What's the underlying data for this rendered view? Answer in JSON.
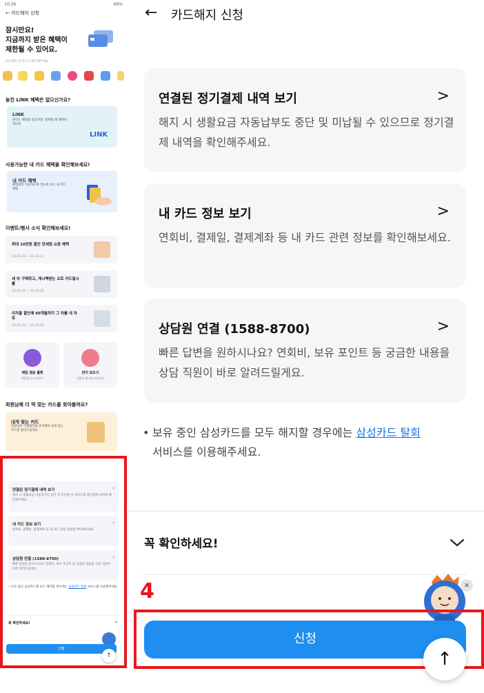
{
  "left_thumb": {
    "status_time": "10:26",
    "status_right": "66%",
    "title": "카드해지 신청",
    "hero_line1": "잠시만요!",
    "hero_line2": "지금까지 받은 혜택이",
    "hero_line3": "제한될 수 있어요.",
    "hero_sub": "카드해지 전 반드시 확인해주세요.",
    "sec_link": "놓친 LINK 혜택은 없으신가요?",
    "link_title": "LINK",
    "link_desc": "원하는 혜택을 링크하면, 결제할 때 혜택이 알아서",
    "link_brand": "LINK",
    "sec_benefit": "사용가능한 내 카드 혜택을 확인해보세요!",
    "benefit_title": "내 카드 혜택",
    "benefit_desc": "빠짐없이 이용하도록 한눈에 보는 내 카드 혜택",
    "sec_event": "이벤트/행사 소식 확인해보세요!",
    "events": [
      {
        "title": "최대 10만원 할인 연세컴 쇼핑 혜택",
        "date": "23.10.23 ~ 23.10.31"
      },
      {
        "title": "새 차 구매하고, 캐시백받는 오토 카드할시롤",
        "date": "23.10.23 ~ 23.10.31"
      },
      {
        "title": "이자율 할인에 60개월까지 그 차를 내 차로",
        "date": "23.10.23 ~ 23.10.31"
      }
    ],
    "tiles": [
      {
        "title": "매일 행운 룰렛",
        "desc": "행운을 만나보세요!"
      },
      {
        "title": "컨더 모으기",
        "desc": "달콤한 캔디와 기다려요"
      }
    ],
    "sec_reco": "회원님께 더 딱 맞는 카드를 찾아볼까요?",
    "reco_title": "내게 맞는 카드",
    "reco_desc": "회원님의 이용패턴을 분석해서 내게 맞는 카드를 찾아드릴게요.",
    "rows": [
      {
        "title": "연결된 정기결제 내역 보기",
        "desc": "해지 시 생활요금 자동납부도 중단 및 미납될 수 있으므로 정기결제 내역을 확인해주세요."
      },
      {
        "title": "내 카드 정보 보기",
        "desc": "연회비, 결제일, 결제계좌 등 내 카드 관련 정보를 확인해보세요."
      },
      {
        "title": "상담원 연결 (1588-8700)",
        "desc": "빠른 답변을 원하시나요? 연회비, 보유 포인트 등 궁금한 내용을 상담 직원이 바로 알려드릴게요."
      }
    ],
    "note_pre": "• 보유 중인 삼성카드를 모두 해지할 경우에는",
    "note_link": "삼성카드 탈회",
    "note_post": "서비스를 이용해주세요.",
    "confirm": "꼭 확인하세요!",
    "button": "신청"
  },
  "header": {
    "back_icon": "←",
    "title": "카드해지 신청"
  },
  "cards": [
    {
      "title": "연결된 정기결제 내역 보기",
      "desc": "해지 시 생활요금 자동납부도 중단 및 미납될 수 있으므로 정기결제 내역을 확인해주세요.",
      "chevron": ">"
    },
    {
      "title": "내 카드 정보 보기",
      "desc": "연회비, 결제일, 결제계좌 등 내 카드 관련 정보를 확인해보세요.",
      "chevron": ">"
    },
    {
      "title": "상담원 연결 (1588-8700)",
      "desc": "빠른 답변을 원하시나요? 연회비, 보유 포인트 등 궁금한 내용을 상담 직원이 바로 알려드릴게요.",
      "chevron": ">"
    }
  ],
  "note": {
    "bullet": "•",
    "pre": "보유 중인 삼성카드를 모두 해지할 경우에는",
    "link": "삼성카드 탈회",
    "post": "서비스를 이용해주세요."
  },
  "confirm": {
    "label": "꼭 확인하세요!",
    "chevron": "∨"
  },
  "annotation": {
    "step_number": "4",
    "highlight_color": "#e8161b"
  },
  "apply_button": {
    "label": "신청",
    "color": "#1f8ef1"
  },
  "floating": {
    "close": "×",
    "scroll_top": "↑",
    "mascot_icon": "chatbot-mascot-icon"
  }
}
